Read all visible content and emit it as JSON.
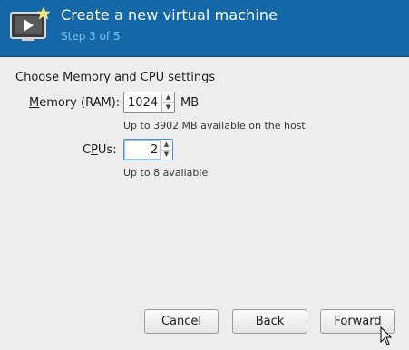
{
  "header": {
    "title": "Create a new virtual machine",
    "step": "Step 3 of 5",
    "icon": "virtual-machine-icon",
    "background": "#1468a8",
    "step_color": "#7fc0f3"
  },
  "section_title": "Choose Memory and CPU settings",
  "memory": {
    "label_accel": "M",
    "label_rest": "emory (RAM):",
    "value": "1024",
    "unit": "MB",
    "hint": "Up to 3902 MB available on the host"
  },
  "cpus": {
    "label_pre": "C",
    "label_accel": "P",
    "label_rest": "Us:",
    "value": "2",
    "hint": "Up to 8 available"
  },
  "buttons": {
    "cancel_accel": "C",
    "cancel_rest": "ancel",
    "back_accel": "B",
    "back_rest": "ack",
    "forward_accel": "F",
    "forward_rest": "orward"
  }
}
